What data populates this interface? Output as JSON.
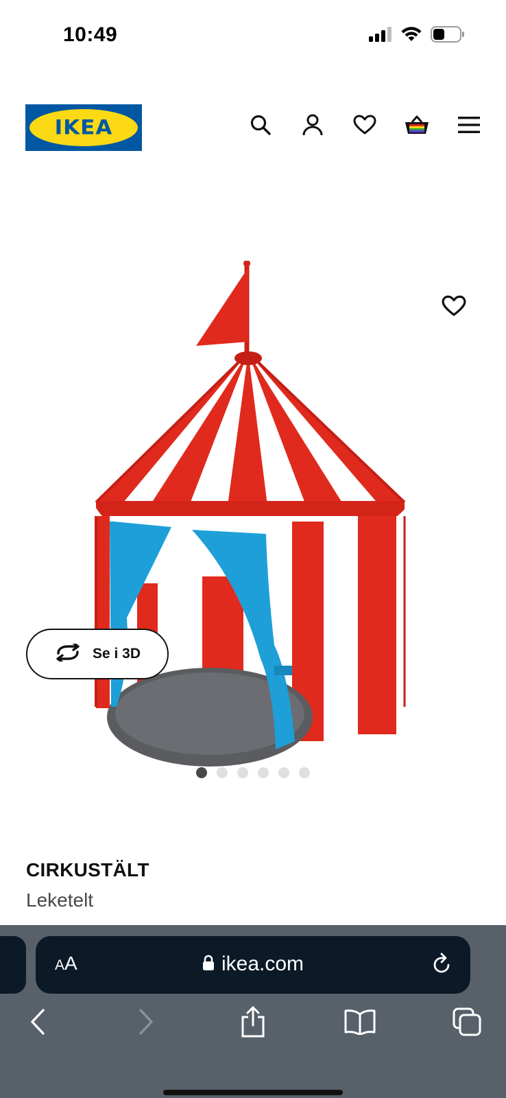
{
  "status_bar": {
    "time": "10:49",
    "icons": [
      "cellular-signal-icon",
      "wifi-icon",
      "battery-icon"
    ]
  },
  "header": {
    "logo_text": "IKEA",
    "icons": [
      "search-icon",
      "account-icon",
      "heart-icon",
      "shopping-bag-icon",
      "menu-icon"
    ]
  },
  "product_media": {
    "view3d_label": "Se i 3D",
    "carousel_count": 6,
    "carousel_active_index": 0
  },
  "product": {
    "name": "CIRKUSTÄLT",
    "type": "Leketelt"
  },
  "browser": {
    "aa_small": "A",
    "aa_large": "A",
    "url": "ikea.com",
    "toolbar_icons": [
      "back-icon",
      "forward-icon",
      "share-icon",
      "bookmarks-icon",
      "tabs-icon"
    ]
  },
  "colors": {
    "ikea_blue": "#0058a3",
    "ikea_yellow": "#fbd914",
    "tent_red": "#e02a1e",
    "tent_blue": "#1e9fd8",
    "safari_bar": "#58616a",
    "address_bar": "#0c1a28"
  }
}
